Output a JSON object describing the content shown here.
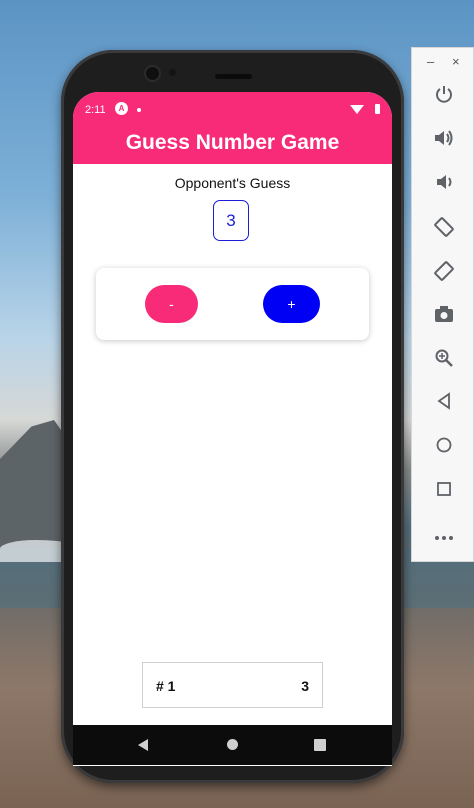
{
  "status_bar": {
    "time": "2:11",
    "notification_letter": "A"
  },
  "app": {
    "title": "Guess Number Game",
    "opponent_label": "Opponent's Guess",
    "current_guess": "3",
    "lower_button": "-",
    "higher_button": "+"
  },
  "guess_log": [
    {
      "round": "# 1",
      "value": "3"
    }
  ],
  "emulator_toolbar": {
    "minimize": "–",
    "close": "×",
    "tools": [
      "power-icon",
      "volume-up-icon",
      "volume-down-icon",
      "rotate-left-icon",
      "rotate-right-icon",
      "camera-icon",
      "zoom-icon",
      "back-icon",
      "home-icon",
      "overview-icon",
      "more-icon"
    ]
  },
  "colors": {
    "primary": "#f72b78",
    "accent": "#0000f5",
    "guess_border": "#1a1fd6"
  }
}
